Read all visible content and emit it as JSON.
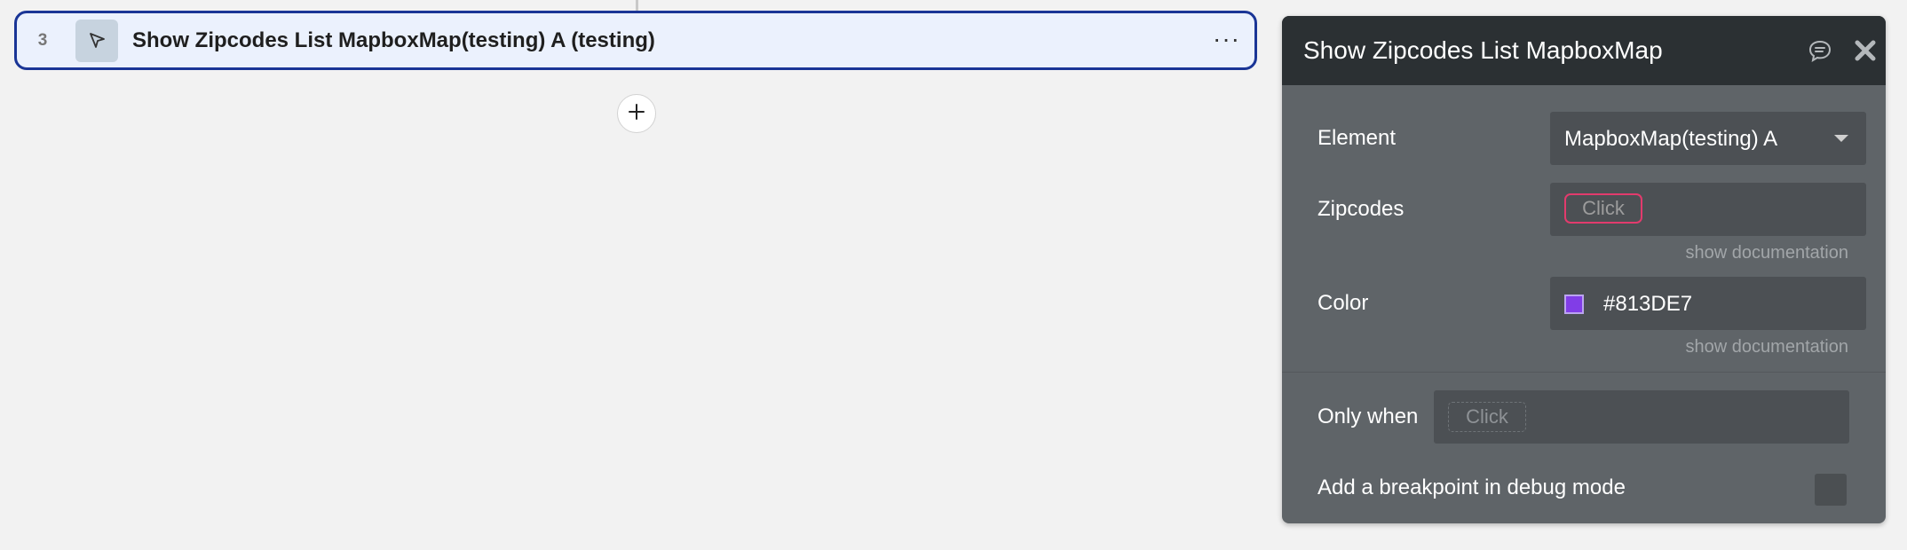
{
  "workflow": {
    "step_number": "3",
    "step_title": "Show Zipcodes List MapboxMap(testing) A (testing)",
    "step_icon": "cursor-arrow-icon",
    "more_icon": "ellipsis-icon",
    "more_label": "···",
    "add_icon": "plus-icon"
  },
  "panel": {
    "title": "Show Zipcodes List MapboxMap",
    "comment_icon": "comment-icon",
    "close_icon": "close-icon",
    "element": {
      "label": "Element",
      "value": "MapboxMap(testing) A"
    },
    "zipcodes": {
      "label": "Zipcodes",
      "placeholder": "Click",
      "doc_link": "show documentation"
    },
    "color": {
      "label": "Color",
      "value": "#813DE7",
      "swatch": "#813DE7",
      "doc_link": "show documentation"
    },
    "only_when": {
      "label": "Only when",
      "placeholder": "Click"
    },
    "breakpoint": {
      "label": "Add a breakpoint in debug mode",
      "checked": false
    }
  },
  "colors": {
    "accent_border": "#1a3596",
    "step_bg": "#ebf1fd",
    "panel_bg": "#5f6468",
    "panel_header_bg": "#2b3033",
    "error_outline": "#e23b6d"
  }
}
